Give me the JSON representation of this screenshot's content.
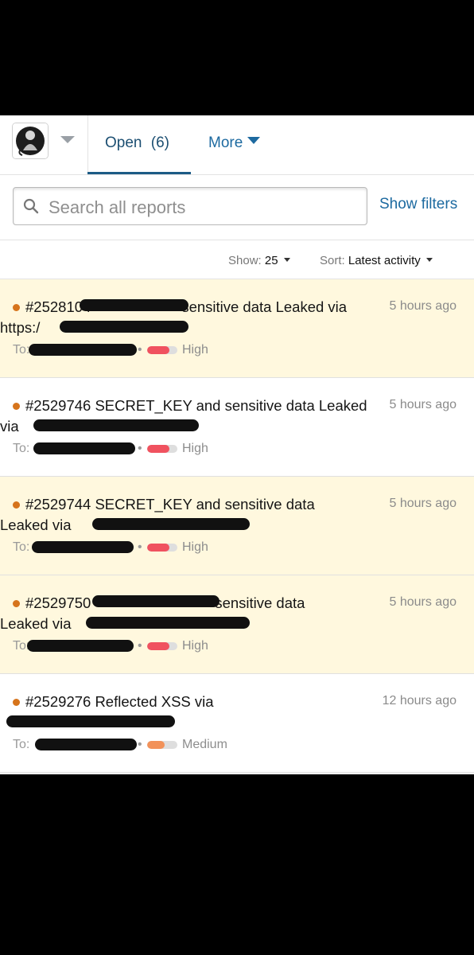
{
  "header": {
    "avatar_icon": "user-avatar-icon",
    "tabs": [
      {
        "label": "Open",
        "count": "(6)"
      },
      {
        "label": "More"
      }
    ]
  },
  "search": {
    "placeholder": "Search all reports",
    "show_filters": "Show filters"
  },
  "controls": {
    "show_label": "Show:",
    "show_value": "25",
    "sort_label": "Sort:",
    "sort_value": "Latest activity"
  },
  "reports": [
    {
      "id_title_visible": "#2528104",
      "title_rest": "sensitive data Leaked via",
      "title_line2": "https:/",
      "time": "5 hours ago",
      "to": "To:",
      "severity": "High",
      "severity_color": "#f0525f",
      "highlighted": true
    },
    {
      "id_title_visible": "#2529746 SECRET_KEY and sensitive data Leaked",
      "title_line2": "via",
      "time": "5 hours ago",
      "to": "To:",
      "severity": "High",
      "severity_color": "#f0525f",
      "highlighted": false
    },
    {
      "id_title_visible": "#2529744 SECRET_KEY and sensitive data",
      "title_line2": "Leaked via",
      "time": "5 hours ago",
      "to": "To:",
      "severity": "High",
      "severity_color": "#f0525f",
      "highlighted": true
    },
    {
      "id_title_visible": "#2529750",
      "title_rest": "sensitive data",
      "title_line2": "Leaked via",
      "time": "5 hours ago",
      "to": "To:",
      "severity": "High",
      "severity_color": "#f0525f",
      "highlighted": true
    },
    {
      "id_title_visible": "#2529276 Reflected XSS via",
      "time": "12 hours ago",
      "to": "To:",
      "severity": "Medium",
      "severity_color": "#f2925a",
      "highlighted": false
    }
  ]
}
